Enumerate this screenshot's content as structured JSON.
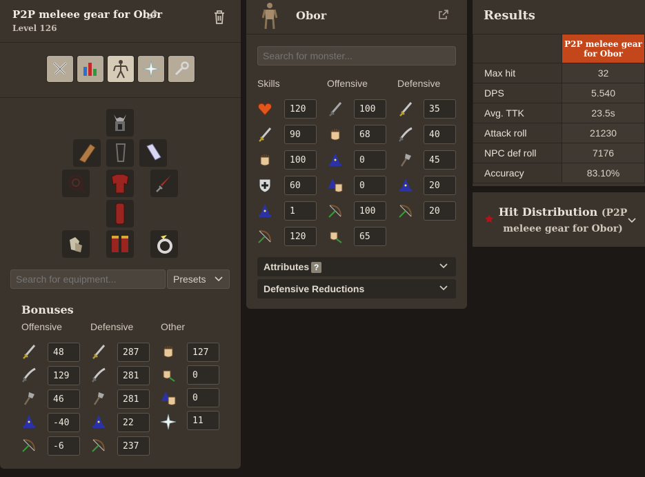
{
  "loadout": {
    "title": "P2P meleee gear for Obor",
    "level": "Level 126"
  },
  "tabs": [
    {
      "name": "combat-style-tab",
      "icon": "crossed-swords-icon"
    },
    {
      "name": "skills-tab",
      "icon": "stats-chart-icon"
    },
    {
      "name": "equipment-tab",
      "icon": "armour-figure-icon",
      "active": true
    },
    {
      "name": "prayer-tab",
      "icon": "prayer-star-icon"
    },
    {
      "name": "options-tab",
      "icon": "wrench-icon"
    }
  ],
  "equipment": {
    "search_placeholder": "Search for equipment...",
    "presets_label": "Presets"
  },
  "bonuses": {
    "title": "Bonuses",
    "headers": {
      "offensive": "Offensive",
      "defensive": "Defensive",
      "other": "Other"
    },
    "offensive": [
      "48",
      "129",
      "46",
      "-40",
      "-6"
    ],
    "defensive": [
      "287",
      "281",
      "281",
      "22",
      "237"
    ],
    "other": [
      "127",
      "0",
      "0",
      "11"
    ]
  },
  "monster": {
    "name": "Obor",
    "search_placeholder": "Search for monster...",
    "headers": {
      "skills": "Skills",
      "offensive": "Offensive",
      "defensive": "Defensive"
    },
    "skills": [
      "120",
      "90",
      "100",
      "60",
      "1",
      "120"
    ],
    "offensive": [
      "100",
      "68",
      "0",
      "0",
      "100",
      "65"
    ],
    "defensive": [
      "35",
      "40",
      "45",
      "20",
      "20"
    ],
    "attributes_label": "Attributes",
    "attributes_help": "?",
    "def_reductions_label": "Defensive Reductions"
  },
  "results": {
    "title": "Results",
    "column": "P2P meleee gear for Obor",
    "rows": [
      {
        "label": "Max hit",
        "value": "32"
      },
      {
        "label": "DPS",
        "value": "5.540"
      },
      {
        "label": "Avg. TTK",
        "value": "23.5s"
      },
      {
        "label": "Attack roll",
        "value": "21230"
      },
      {
        "label": "NPC def roll",
        "value": "7176"
      },
      {
        "label": "Accuracy",
        "value": "83.10%"
      }
    ]
  },
  "hit_distribution": {
    "title": "Hit Distribution",
    "subtitle": "(P2P meleee gear for Obor)"
  },
  "colors": {
    "panel": "#3a342d",
    "background": "#1b1816",
    "accent": "#c4471c"
  }
}
